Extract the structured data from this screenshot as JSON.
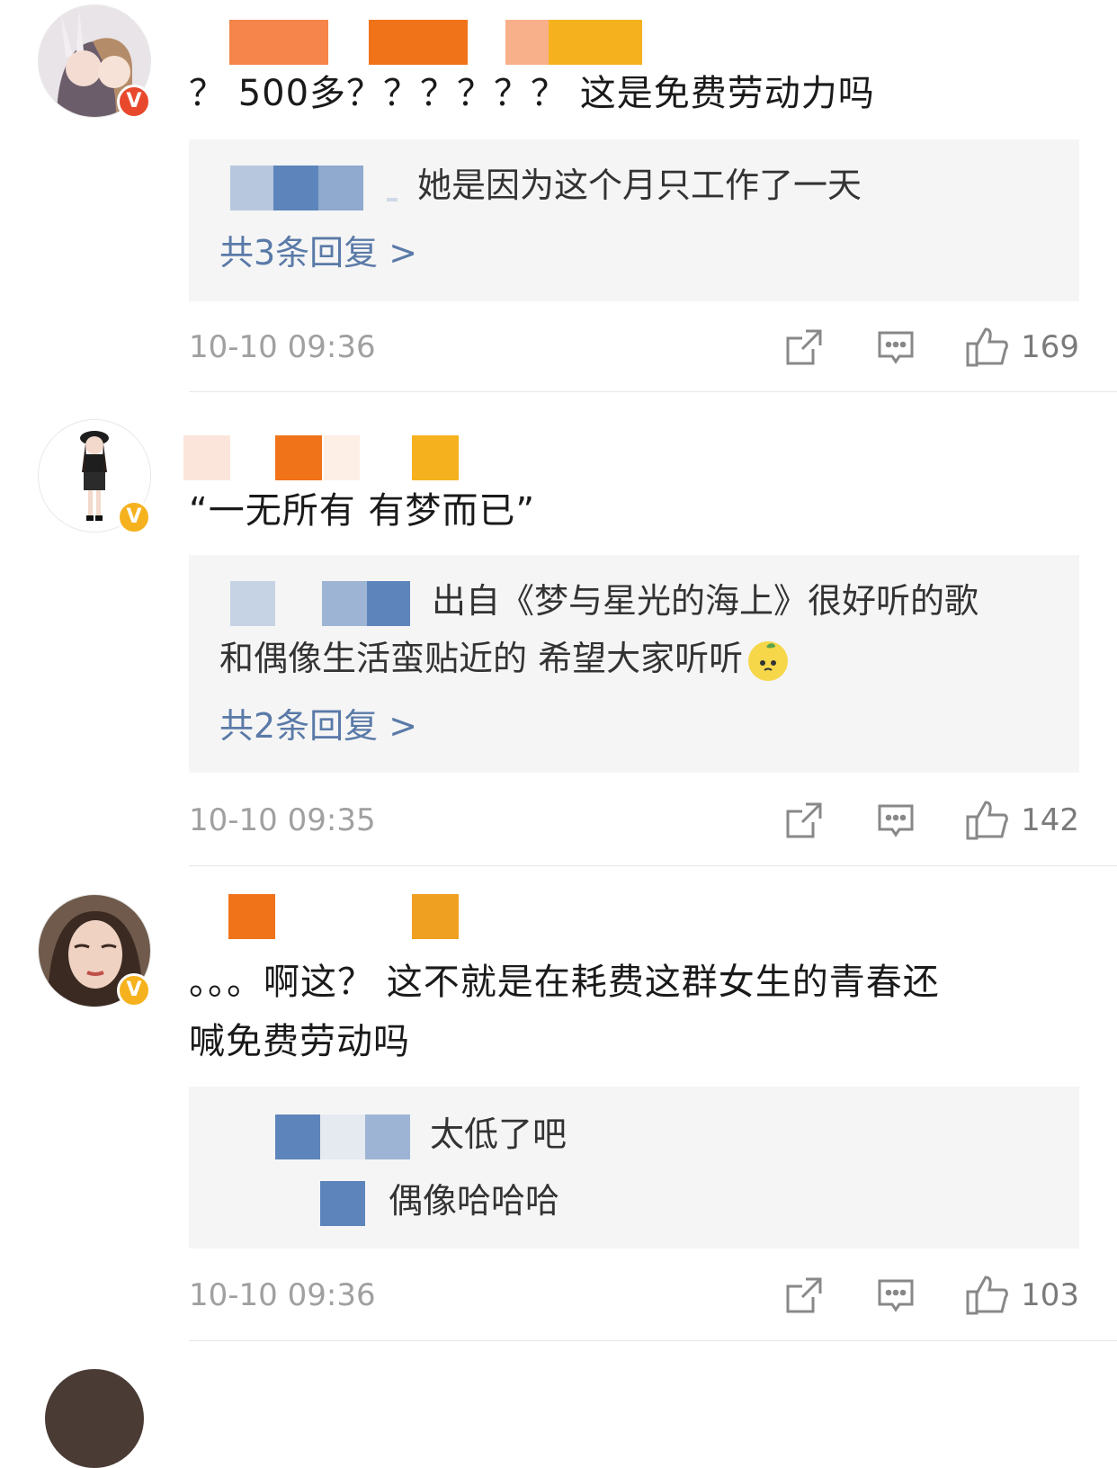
{
  "comments": [
    {
      "text": "？ 500多？？？？？？ 这是免费劳动力吗",
      "badge": "V",
      "replies": [
        {
          "text": "她是因为这个月只工作了一天"
        }
      ],
      "more_label": "共3条回复 >",
      "time": "10-10 09:36",
      "likes": "169"
    },
    {
      "text": "“一无所有 有梦而已”",
      "badge": "V",
      "replies": [
        {
          "text": "出自《梦与星光的海上》很好听的歌"
        },
        {
          "text": "和偶像生活蛮贴近的 希望大家听听"
        }
      ],
      "more_label": "共2条回复 >",
      "time": "10-10 09:35",
      "likes": "142"
    },
    {
      "text_line1": "。。。啊这？ 这不就是在耗费这群女生的青春还",
      "text_line2": "喊免费劳动吗",
      "badge": "V",
      "replies": [
        {
          "text": "太低了吧"
        },
        {
          "text": "偶像哈哈哈"
        }
      ],
      "time": "10-10 09:36",
      "likes": "103"
    }
  ],
  "icons": {
    "share": "share-icon",
    "comment": "comment-icon",
    "like": "thumbs-up-icon"
  },
  "colors": {
    "link": "#5a7aa8",
    "badge_red": "#e8492c",
    "badge_gold": "#f6b21e"
  }
}
